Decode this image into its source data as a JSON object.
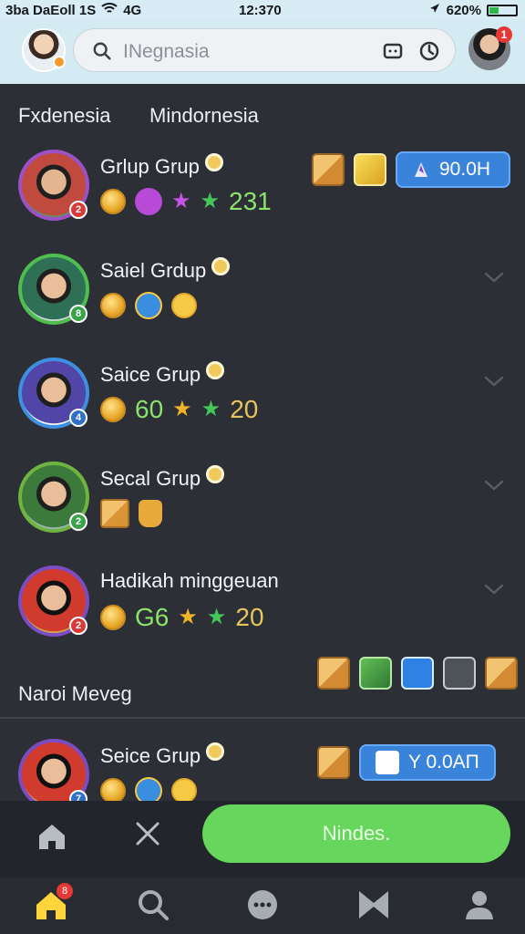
{
  "status": {
    "carrier": "3ba DaEoll 1S",
    "network": "4G",
    "time": "12:370",
    "battery": "620%"
  },
  "header": {
    "search_placeholder": "INegnasia",
    "profile_badge": "1"
  },
  "tabs": [
    "Fxdenesia",
    "Mindornesia"
  ],
  "rows": [
    {
      "title": "Grlup Grup",
      "count": "231",
      "badge": "2",
      "action_label": "90.0H"
    },
    {
      "title": "Saiel Grdup",
      "badge": "8"
    },
    {
      "title": "Saice Grup",
      "coin_count": "60",
      "count": "20",
      "badge": "4"
    },
    {
      "title": "Secal Grup",
      "badge": "2"
    },
    {
      "title": "Hadikah minggeuan",
      "coin_count": "G6",
      "count": "20",
      "badge": "2"
    }
  ],
  "section": {
    "heading": "Naroi Meveg"
  },
  "section_row": {
    "title": "Seice Grup",
    "badge": "7",
    "action_label": "Y 0.0AП"
  },
  "primary_action": {
    "label": "Nindes."
  },
  "nav": {
    "home_badge": "8"
  },
  "colors": {
    "background": "#2c2f36",
    "header": "#d5ebf4",
    "primary": "#67d65c",
    "accent": "#3a83da"
  },
  "icons": {
    "search": "search-icon",
    "scan": "scan-icon",
    "clock": "clock-icon",
    "chevron": "chevron-down-icon",
    "home": "home-icon",
    "search_nav": "search-icon",
    "chat": "chat-icon",
    "bookmark": "bookmark-icon",
    "profile": "user-icon"
  }
}
